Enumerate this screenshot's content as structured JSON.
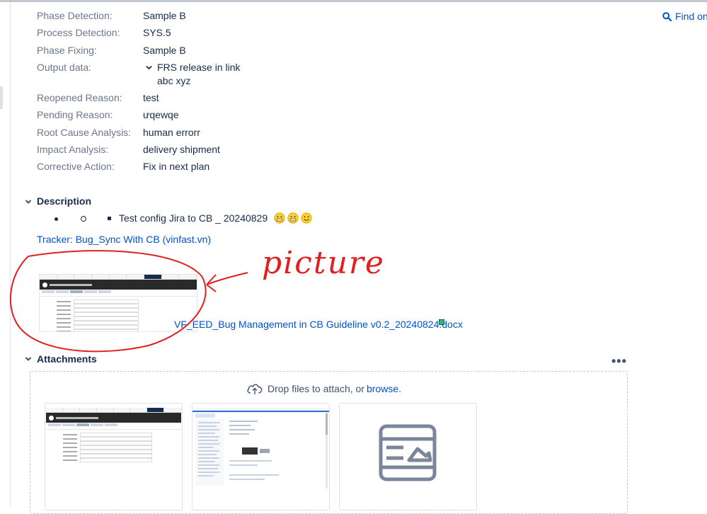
{
  "find_on": {
    "label": "Find on"
  },
  "fields": [
    {
      "label": "Phase Detection:",
      "value": "Sample B"
    },
    {
      "label": "Process Detection:",
      "value": "SYS.5"
    },
    {
      "label": "Phase Fixing:",
      "value": "Sample B"
    },
    {
      "label": "Output data:",
      "value": ""
    },
    {
      "label": "Reopened Reason:",
      "value": "test"
    },
    {
      "label": "Pending Reason:",
      "value": "ưqewqe"
    },
    {
      "label": "Root Cause Analysis:",
      "value": "human errorr"
    },
    {
      "label": "Impact Analysis:",
      "value": "delivery shipment"
    },
    {
      "label": "Corrective Action:",
      "value": "Fix in next plan"
    }
  ],
  "output_data": {
    "link": "FRS release in link",
    "sub": "abc xyz"
  },
  "description": {
    "title": "Description",
    "text": "Test config Jira to CB _ 20240829",
    "tracker_link": "Tracker: Bug_Sync With CB (vinfast.vn)",
    "doc_link": "VF_EED_Bug Management in CB Guideline v0.2_20240824.docx",
    "annotation": "picture"
  },
  "attachments": {
    "title": "Attachments",
    "more": "•••",
    "drop_text": "Drop files to attach, or",
    "browse": "browse",
    "drop_end": "."
  },
  "colors": {
    "link": "#0052cc",
    "annotation": "#e02020",
    "label": "#6b778c"
  }
}
